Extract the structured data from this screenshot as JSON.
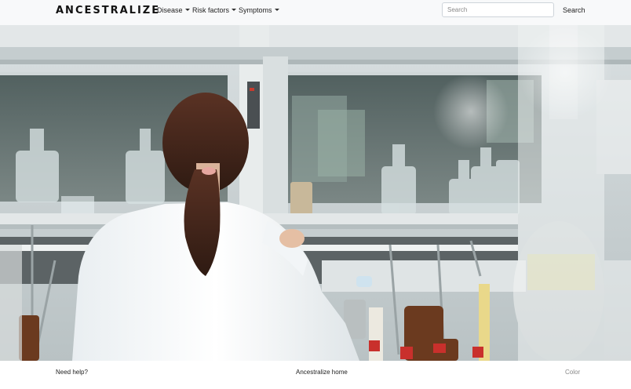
{
  "navbar": {
    "brand": "ANCESTRALIZE",
    "menu": [
      {
        "label": "Disease"
      },
      {
        "label": "Risk factors"
      },
      {
        "label": "Symptoms"
      }
    ],
    "search": {
      "placeholder": "Search",
      "button_label": "Search"
    }
  },
  "hero": {
    "image": "laboratory-photo"
  },
  "footer": {
    "help_label": "Need help?",
    "home_label": "Ancestralize home",
    "color_label": "Color"
  }
}
